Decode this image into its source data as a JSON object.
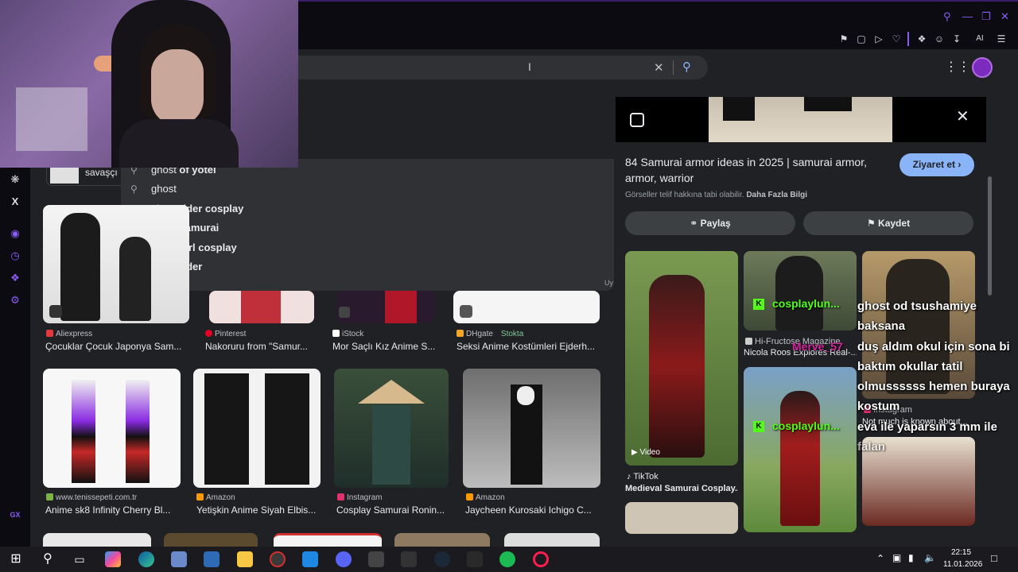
{
  "browser": {
    "toolbar_ai_label": "AI",
    "gx_label": "GX"
  },
  "search": {
    "clear_icon": "close-icon",
    "search_icon": "search-icon",
    "chip_label": "savaşçı"
  },
  "suggestions": [
    {
      "prefix": "ghost",
      "suffix": " of yotei"
    },
    {
      "prefix": "ghost",
      "suffix": ""
    },
    {
      "prefix": "ghost",
      "suffix": " rider cosplay"
    },
    {
      "prefix": "ghost",
      "suffix": " samurai"
    },
    {
      "prefix": "ghost",
      "suffix": " girl cosplay"
    },
    {
      "prefix": "ghost",
      "suffix": " rider"
    }
  ],
  "suggest_footer": "Uy",
  "results_row1": [
    {
      "source": "Aliexpress",
      "title": "Çocuklar Çocuk Japonya Sam...",
      "color": "#e4393c"
    },
    {
      "source": "Pinterest",
      "title": "Nakoruru from \"Samur...",
      "color": "#e60023"
    },
    {
      "source": "iStock",
      "title": "Mor Saçlı Kız Anime S...",
      "color": "#ffffff"
    },
    {
      "source": "DHgate",
      "badge": "Stokta",
      "title": "Seksi Anime Kostümleri Ejderh...",
      "color": "#f5a623"
    }
  ],
  "results_row2": [
    {
      "source": "www.tenissepeti.com.tr",
      "title": "Anime sk8 Infinity Cherry Bl...",
      "color": "#7cb342"
    },
    {
      "source": "Amazon",
      "title": "Yetişkin Anime Siyah Elbis...",
      "color": "#ff9900"
    },
    {
      "source": "Instagram",
      "title": "Cosplay Samurai Ronin...",
      "color": "#e1306c"
    },
    {
      "source": "Amazon",
      "title": "Jaycheen Kurosaki Ichigo C...",
      "color": "#ff9900"
    }
  ],
  "panel": {
    "title": "84 Samurai armor ideas in 2025 | samurai armor, armor, warrior",
    "visit_label": "Ziyaret et",
    "copyright_text": "Görseller telif hakkına tabi olabilir.",
    "more_info": "Daha Fazla Bilgi",
    "share_label": "Paylaş",
    "save_label": "Kaydet",
    "related": [
      {
        "video_label": "Video",
        "source": "TikTok",
        "title": "Medieval Samurai Cosplay..."
      },
      {
        "channel": "cosplaylun...",
        "source": "Hi-Fructose Magazine",
        "title": "Nicola Roos Explores Real-..."
      },
      {
        "channel": "cosplaylun...",
        "source": "Instagram",
        "title": "Not much is known about..."
      }
    ]
  },
  "chat_overlay": {
    "user": "Merve_57",
    "lines": [
      "ghost od tsushamiye",
      "baksana",
      "duş aldım okul için sona bi",
      "baktım okullar tatil",
      "olmussssss hemen buraya",
      "kostum",
      "eva ile yaparsın 3 mm ile",
      "falan"
    ]
  },
  "taskbar": {
    "time": "22:15",
    "date": "11.01.2026"
  }
}
